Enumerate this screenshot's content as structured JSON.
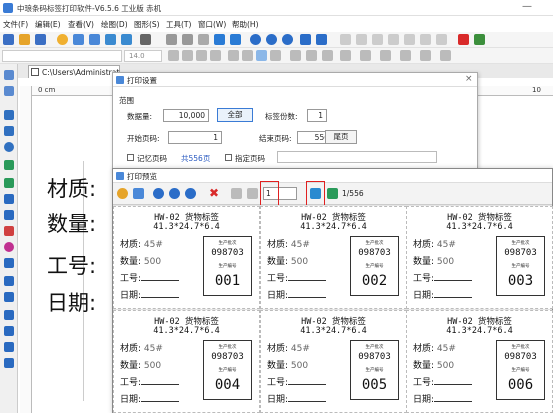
{
  "title": "中琅条码标签打印软件-V6.5.6 工业版 赤机",
  "window_min": "—",
  "menu": [
    "文件(F)",
    "编辑(E)",
    "查看(V)",
    "绘图(D)",
    "图形(S)",
    "工具(T)",
    "窗口(W)",
    "帮助(H)"
  ],
  "font_size": "14.0",
  "doc_tab": "C:\\Users\\Administrat",
  "ruler": {
    "zero": "0 cm",
    "one": "1",
    "ten": "10"
  },
  "canvas_labels": [
    "材质:",
    "数量:",
    "工号:",
    "日期:"
  ],
  "print_dialog": {
    "title": "打印设置",
    "section": "范围",
    "qty_label": "数据量:",
    "qty_value": "10,000",
    "all_button": "全部",
    "copies_label": "标签份数:",
    "copies_value": "1",
    "start_label": "开始页码:",
    "start_value": "1",
    "end_label": "结束页码:",
    "end_value": "556",
    "last_button": "尾页",
    "remember_label": "记忆页码",
    "total_pages": "共556页",
    "specify_label": "指定页码"
  },
  "preview": {
    "title": "打印预览",
    "page_input": "1",
    "page_total": "1/556",
    "cards": [
      {
        "title": "HW-02 货物标签",
        "size": "41.3*24.7*6.4",
        "material_label": "材质:",
        "material": "45#",
        "qty_label": "数量:",
        "qty": "500",
        "worker_label": "工号:",
        "date_label": "日期:",
        "batch_label": "生产批次",
        "batch": "098703",
        "num_label": "生产编号",
        "num": "001"
      },
      {
        "title": "HW-02 货物标签",
        "size": "41.3*24.7*6.4",
        "material_label": "材质:",
        "material": "45#",
        "qty_label": "数量:",
        "qty": "500",
        "worker_label": "工号:",
        "date_label": "日期:",
        "batch_label": "生产批次",
        "batch": "098703",
        "num_label": "生产编号",
        "num": "002"
      },
      {
        "title": "HW-02 货物标签",
        "size": "41.3*24.7*6.4",
        "material_label": "材质:",
        "material": "45#",
        "qty_label": "数量:",
        "qty": "500",
        "worker_label": "工号:",
        "date_label": "日期:",
        "batch_label": "生产批次",
        "batch": "098703",
        "num_label": "生产编号",
        "num": "003"
      },
      {
        "title": "HW-02 货物标签",
        "size": "41.3*24.7*6.4",
        "material_label": "材质:",
        "material": "45#",
        "qty_label": "数量:",
        "qty": "500",
        "worker_label": "工号:",
        "date_label": "日期:",
        "batch_label": "生产批次",
        "batch": "098703",
        "num_label": "生产编号",
        "num": "004"
      },
      {
        "title": "HW-02 货物标签",
        "size": "41.3*24.7*6.4",
        "material_label": "材质:",
        "material": "45#",
        "qty_label": "数量:",
        "qty": "500",
        "worker_label": "工号:",
        "date_label": "日期:",
        "batch_label": "生产批次",
        "batch": "098703",
        "num_label": "生产编号",
        "num": "005"
      },
      {
        "title": "HW-02 货物标签",
        "size": "41.3*24.7*6.4",
        "material_label": "材质:",
        "material": "45#",
        "qty_label": "数量:",
        "qty": "500",
        "worker_label": "工号:",
        "date_label": "日期:",
        "batch_label": "生产批次",
        "batch": "098703",
        "num_label": "生产编号",
        "num": "006"
      }
    ]
  }
}
